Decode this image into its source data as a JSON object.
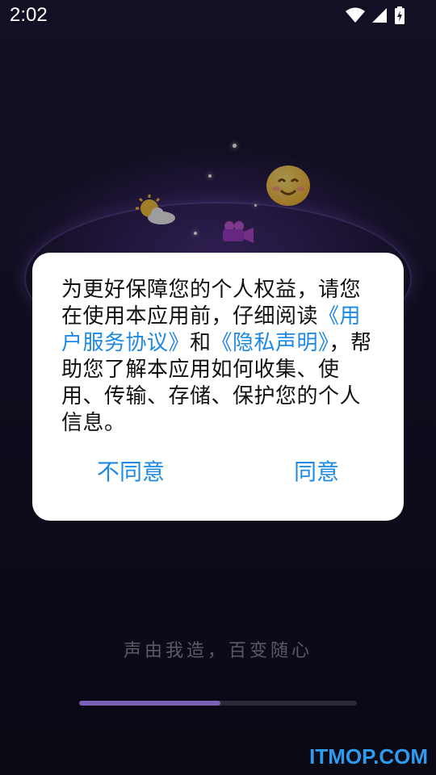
{
  "status_bar": {
    "time": "2:02",
    "icons": [
      "wifi-icon",
      "signal-icon",
      "battery-charging-icon"
    ]
  },
  "dialog": {
    "text_parts": [
      {
        "text": "为更好保障您的个人权益，请您在使用本应用前，仔细阅读",
        "type": "plain"
      },
      {
        "text": "《用户服务协议》",
        "type": "link"
      },
      {
        "text": "和",
        "type": "plain"
      },
      {
        "text": "《隐私声明》",
        "type": "link"
      },
      {
        "text": "，帮助您了解本应用如何收集、使用、传输、存储、保护您的个人信息。",
        "type": "plain"
      }
    ],
    "disagree_label": "不同意",
    "agree_label": "同意"
  },
  "slogan": "声由我造，百变随心",
  "loading": {
    "progress": 0.51
  },
  "watermark": "ITMOP.COM",
  "colors": {
    "link": "#1e88e5",
    "accent": "#7a62b8",
    "watermark": "#2f9bef"
  }
}
